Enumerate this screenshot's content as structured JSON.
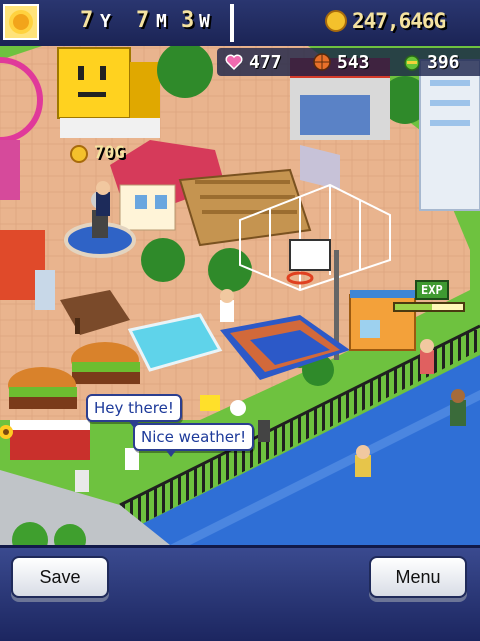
{
  "hud": {
    "date": {
      "years": "7",
      "year_unit": "Y",
      "months": "7",
      "month_unit": "M",
      "weeks": "3",
      "week_unit": "W"
    },
    "money": "247,646G",
    "season_icon": "sunflower-icon"
  },
  "resources": {
    "hearts": {
      "icon": "heart-icon",
      "value": "477"
    },
    "basketballs": {
      "icon": "basketball-icon",
      "value": "543"
    },
    "seeds": {
      "icon": "seed-icon",
      "value": "396"
    }
  },
  "popups": {
    "income": "70G",
    "exp_label": "EXP",
    "exp_progress": 0.55
  },
  "speech": {
    "bubble1": "Hey there!",
    "bubble2": "Nice weather!"
  },
  "menu": {
    "save_label": "Save",
    "menu_label": "Menu"
  },
  "colors": {
    "hud_background": "#1f2b63",
    "money_text": "#f4e2a0",
    "grass": "#6ec23f",
    "road": "#2f6fd6"
  }
}
